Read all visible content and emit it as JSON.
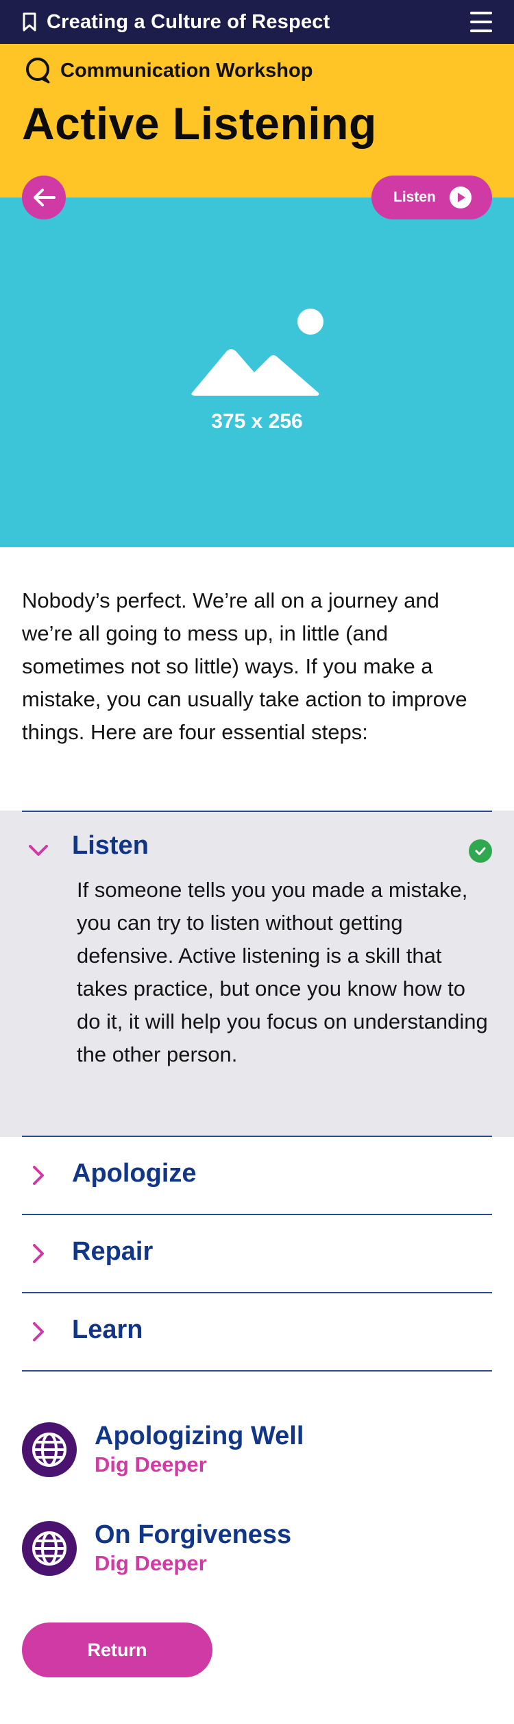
{
  "topbar": {
    "title": "Creating a Culture of Respect",
    "bookmark_icon": "bookmark-icon",
    "menu_icon": "hamburger-menu-icon"
  },
  "header": {
    "kicker": "Communication Workshop",
    "title": "Active Listening"
  },
  "hero": {
    "listen_label": "Listen",
    "placeholder_label": "375 x 256"
  },
  "intro": "Nobody’s perfect. We’re all on a journey and we’re all going to mess up, in little (and sometimes not so little) ways. If you make a mistake, you can usually take action to improve things. Here are four essential steps:",
  "accordion": {
    "items": [
      {
        "title": "Listen",
        "expanded": true,
        "completed": true,
        "body": "If someone tells you you made a mistake, you can try to listen without getting defensive. Active listening is a skill that takes practice, but once you know how to do it, it will help you focus on understanding the other person."
      },
      {
        "title": "Apologize",
        "expanded": false
      },
      {
        "title": "Repair",
        "expanded": false
      },
      {
        "title": "Learn",
        "expanded": false
      }
    ]
  },
  "dig_deeper": [
    {
      "title": "Apologizing Well",
      "subtitle": "Dig Deeper"
    },
    {
      "title": "On Forgiveness",
      "subtitle": "Dig Deeper"
    }
  ],
  "return_label": "Return",
  "colors": {
    "navy": "#1c1d4a",
    "yellow": "#ffc425",
    "teal": "#3cc5d9",
    "magenta": "#cf3aa4",
    "blue": "#123687",
    "purple": "#4b1370",
    "green": "#2fa84f"
  }
}
